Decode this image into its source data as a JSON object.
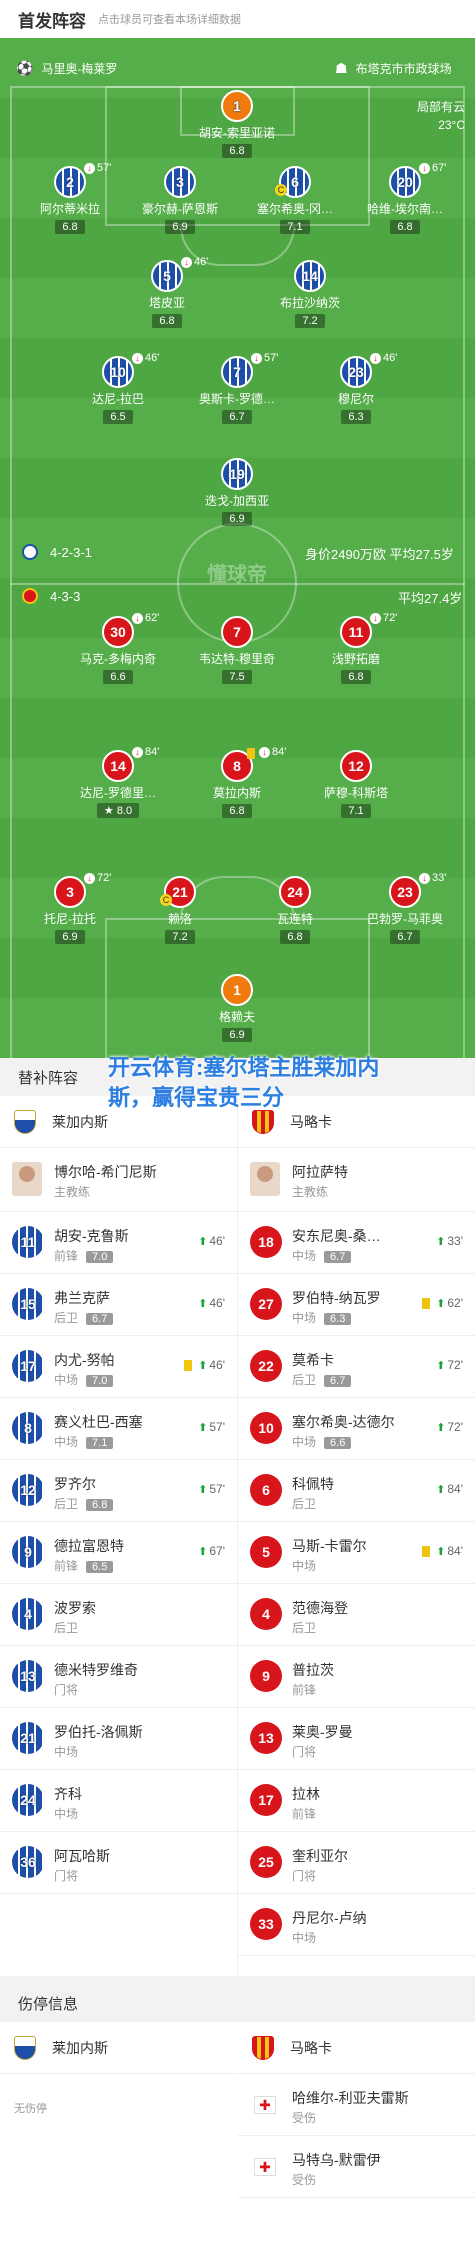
{
  "header": {
    "title": "首发阵容",
    "subtitle": "点击球员可查看本场详细数据"
  },
  "venue": {
    "stadium": "马里奥-梅莱罗",
    "location": "布塔克市市政球场"
  },
  "weather": {
    "label": "局部有云",
    "temp": "23°C"
  },
  "watermark": "懂球帝",
  "home_formation": {
    "formation": "4-2-3-1",
    "value_text": "身价2490万欧 平均27.5岁"
  },
  "away_formation": {
    "formation": "4-3-3",
    "age_text": "平均27.4岁"
  },
  "home_players": [
    {
      "num": "1",
      "name": "胡安-索里亚诺",
      "rating": "6.8"
    },
    {
      "num": "2",
      "name": "阿尔蒂米拉",
      "rating": "6.8",
      "sub": "57'"
    },
    {
      "num": "3",
      "name": "豪尔赫-萨恩斯",
      "rating": "6.9"
    },
    {
      "num": "6",
      "name": "塞尔希奥-冈…",
      "rating": "7.1"
    },
    {
      "num": "20",
      "name": "哈维-埃尔南…",
      "rating": "6.8",
      "sub": "67'"
    },
    {
      "num": "5",
      "name": "塔皮亚",
      "rating": "6.8",
      "sub": "46'"
    },
    {
      "num": "14",
      "name": "布拉沙纳茨",
      "rating": "7.2"
    },
    {
      "num": "10",
      "name": "达尼-拉巴",
      "rating": "6.5",
      "sub": "46'"
    },
    {
      "num": "7",
      "name": "奥斯卡-罗德…",
      "rating": "6.7",
      "sub": "57'"
    },
    {
      "num": "23",
      "name": "穆尼尔",
      "rating": "6.3",
      "sub": "46'"
    },
    {
      "num": "19",
      "name": "迭戈-加西亚",
      "rating": "6.9"
    }
  ],
  "away_players": [
    {
      "num": "30",
      "name": "马克-多梅内奇",
      "rating": "6.6",
      "sub": "62'"
    },
    {
      "num": "7",
      "name": "韦达特-穆里奇",
      "rating": "7.5"
    },
    {
      "num": "11",
      "name": "浅野拓磨",
      "rating": "6.8",
      "sub": "72'"
    },
    {
      "num": "14",
      "name": "达尼-罗德里…",
      "rating": "8.0",
      "sub": "84'"
    },
    {
      "num": "8",
      "name": "莫拉内斯",
      "rating": "6.8",
      "sub": "84'"
    },
    {
      "num": "12",
      "name": "萨穆-科斯塔",
      "rating": "7.1"
    },
    {
      "num": "3",
      "name": "托尼-拉托",
      "rating": "6.9",
      "sub": "72'"
    },
    {
      "num": "21",
      "name": "赖洛",
      "rating": "7.2"
    },
    {
      "num": "24",
      "name": "瓦连特",
      "rating": "6.8"
    },
    {
      "num": "23",
      "name": "巴勃罗-马菲奥",
      "rating": "6.7",
      "sub": "33'"
    },
    {
      "num": "1",
      "name": "格赖夫",
      "rating": "6.9"
    }
  ],
  "subs": {
    "title": "替补阵容",
    "home_team": "莱加内斯",
    "away_team": "马略卡",
    "home_coach": {
      "name": "博尔哈-希门尼斯",
      "role": "主教练"
    },
    "away_coach": {
      "name": "阿拉萨特",
      "role": "主教练"
    },
    "home": [
      {
        "num": "11",
        "name": "胡安-克鲁斯",
        "pos": "前锋",
        "rating": "7.0",
        "time": "46'"
      },
      {
        "num": "15",
        "name": "弗兰克萨",
        "pos": "后卫",
        "rating": "6.7",
        "time": "46'"
      },
      {
        "num": "17",
        "name": "内尤-努帕",
        "pos": "中场",
        "rating": "7.0",
        "time": "46'"
      },
      {
        "num": "8",
        "name": "赛义杜巴-西塞",
        "pos": "中场",
        "rating": "7.1",
        "time": "57'"
      },
      {
        "num": "12",
        "name": "罗齐尔",
        "pos": "后卫",
        "rating": "6.8",
        "time": "57'"
      },
      {
        "num": "9",
        "name": "德拉富恩特",
        "pos": "前锋",
        "rating": "6.5",
        "time": "67'"
      },
      {
        "num": "4",
        "name": "波罗索",
        "pos": "后卫"
      },
      {
        "num": "13",
        "name": "德米特罗维奇",
        "pos": "门将"
      },
      {
        "num": "21",
        "name": "罗伯托-洛佩斯",
        "pos": "中场"
      },
      {
        "num": "24",
        "name": "齐科",
        "pos": "中场"
      },
      {
        "num": "36",
        "name": "阿瓦哈斯",
        "pos": "门将"
      }
    ],
    "away": [
      {
        "num": "18",
        "name": "安东尼奥-桑…",
        "pos": "中场",
        "rating": "6.7",
        "time": "33'"
      },
      {
        "num": "27",
        "name": "罗伯特-纳瓦罗",
        "pos": "中场",
        "rating": "6.3",
        "time": "62'"
      },
      {
        "num": "22",
        "name": "莫希卡",
        "pos": "后卫",
        "rating": "6.7",
        "time": "72'"
      },
      {
        "num": "10",
        "name": "塞尔希奥-达德尔",
        "pos": "中场",
        "rating": "6.6",
        "time": "72'"
      },
      {
        "num": "6",
        "name": "科佩特",
        "pos": "后卫",
        "time": "84'"
      },
      {
        "num": "5",
        "name": "马斯-卡雷尔",
        "pos": "中场",
        "time": "84'"
      },
      {
        "num": "4",
        "name": "范德海登",
        "pos": "后卫"
      },
      {
        "num": "9",
        "name": "普拉茨",
        "pos": "前锋"
      },
      {
        "num": "13",
        "name": "莱奥-罗曼",
        "pos": "门将"
      },
      {
        "num": "17",
        "name": "拉林",
        "pos": "前锋"
      },
      {
        "num": "25",
        "name": "奎利亚尔",
        "pos": "门将"
      },
      {
        "num": "33",
        "name": "丹尼尔-卢纳",
        "pos": "中场"
      }
    ]
  },
  "banner": "开云体育:塞尔塔主胜莱加内斯，赢得宝贵三分",
  "injuries": {
    "title": "伤停信息",
    "home_team": "莱加内斯",
    "away_team": "马略卡",
    "home_none": "无伤停",
    "away": [
      {
        "name": "哈维尔-利亚夫雷斯",
        "status": "受伤"
      },
      {
        "name": "马特乌-默雷伊",
        "status": "受伤"
      }
    ]
  }
}
